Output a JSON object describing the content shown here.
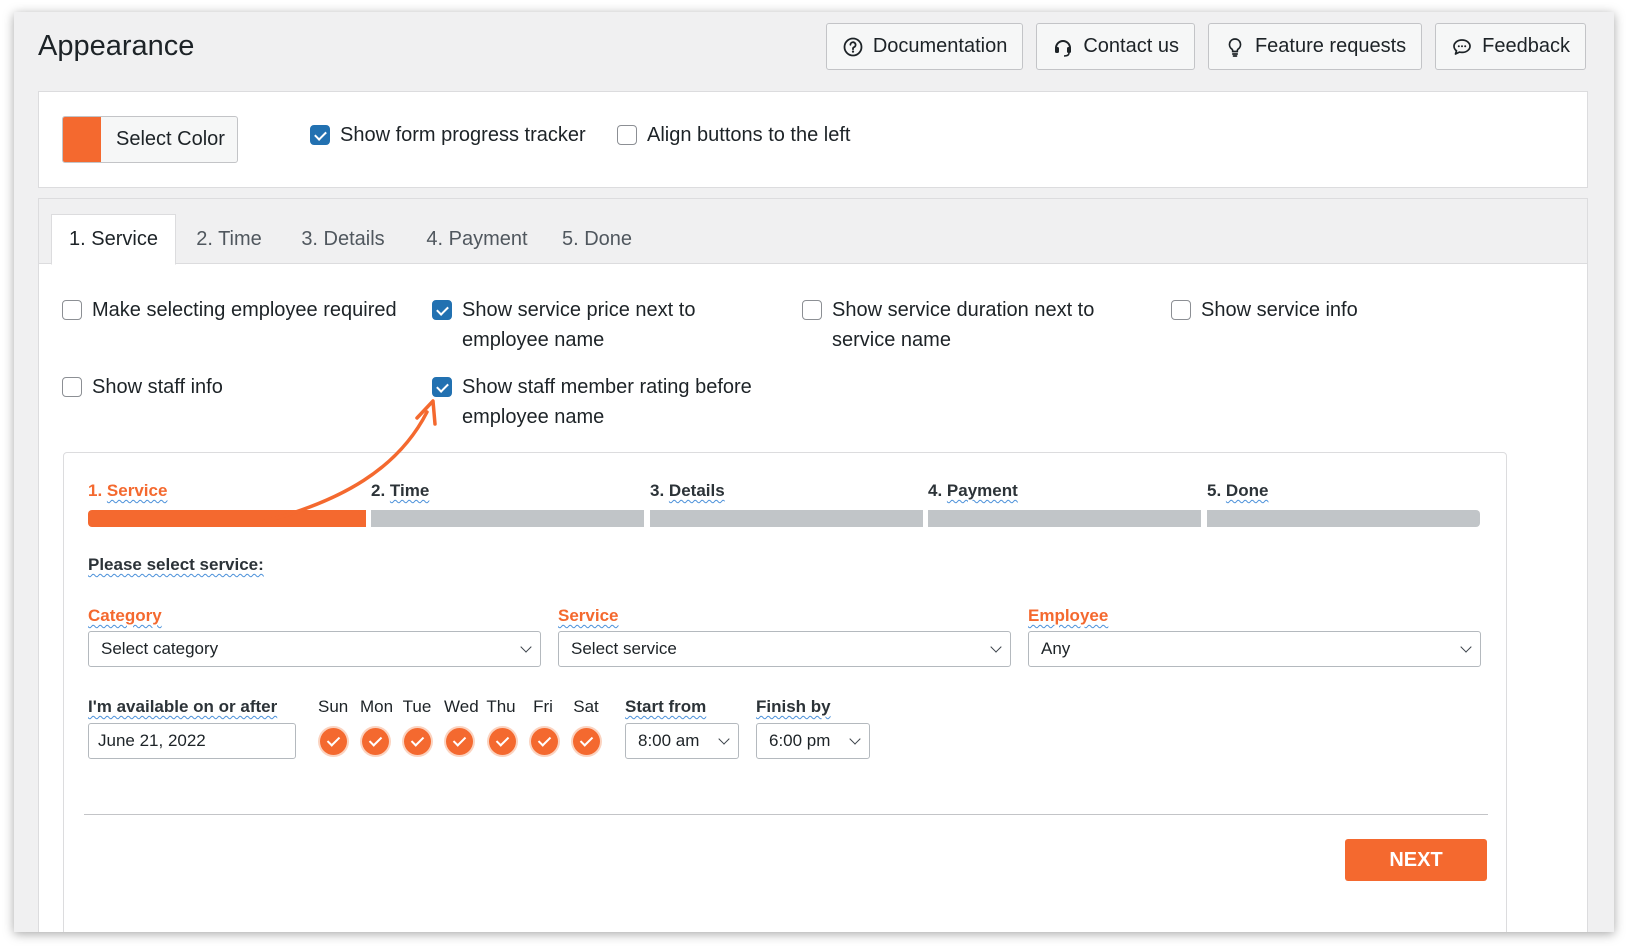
{
  "page": {
    "title": "Appearance"
  },
  "top_buttons": [
    {
      "label": "Documentation",
      "icon": "question-circle-icon"
    },
    {
      "label": "Contact us",
      "icon": "headset-icon"
    },
    {
      "label": "Feature requests",
      "icon": "lightbulb-icon"
    },
    {
      "label": "Feedback",
      "icon": "chat-bubble-icon"
    }
  ],
  "settings": {
    "color_button_label": "Select Color",
    "color": "#f4692f",
    "show_progress_tracker": {
      "label": "Show form progress tracker",
      "checked": true
    },
    "align_buttons_left": {
      "label": "Align buttons to the left",
      "checked": false
    }
  },
  "tabs": [
    {
      "label": "1. Service",
      "active": true
    },
    {
      "label": "2. Time",
      "active": false
    },
    {
      "label": "3. Details",
      "active": false
    },
    {
      "label": "4. Payment",
      "active": false
    },
    {
      "label": "5. Done",
      "active": false
    }
  ],
  "options": [
    {
      "line1": "Make selecting employee required",
      "line2": "",
      "checked": false
    },
    {
      "line1": "Show service price next to",
      "line2": "employee name",
      "checked": true
    },
    {
      "line1": "Show service duration next to",
      "line2": "service name",
      "checked": false
    },
    {
      "line1": "Show service info",
      "line2": "",
      "checked": false
    },
    {
      "line1": "Show staff info",
      "line2": "",
      "checked": false
    },
    {
      "line1": "Show staff member rating before",
      "line2": "employee name",
      "checked": true
    }
  ],
  "preview": {
    "steps": [
      {
        "num": "1.",
        "name": "Service",
        "done": true
      },
      {
        "num": "2.",
        "name": "Time",
        "done": false
      },
      {
        "num": "3.",
        "name": "Details",
        "done": false
      },
      {
        "num": "4.",
        "name": "Payment",
        "done": false
      },
      {
        "num": "5.",
        "name": "Done",
        "done": false
      }
    ],
    "prompt": "Please select service:",
    "category": {
      "label": "Category",
      "value": "Select category"
    },
    "service": {
      "label": "Service",
      "value": "Select service"
    },
    "employee": {
      "label": "Employee",
      "value": "Any"
    },
    "available_label": "I'm available on or after",
    "date_value": "June 21, 2022",
    "days": [
      "Sun",
      "Mon",
      "Tue",
      "Wed",
      "Thu",
      "Fri",
      "Sat"
    ],
    "days_checked": [
      true,
      true,
      true,
      true,
      true,
      true,
      true
    ],
    "start_from": {
      "label": "Start from",
      "value": "8:00 am"
    },
    "finish_by": {
      "label": "Finish by",
      "value": "6:00 pm"
    },
    "next_label": "NEXT"
  },
  "accent": "#f4692f",
  "checkbox_color": "#2271b1"
}
